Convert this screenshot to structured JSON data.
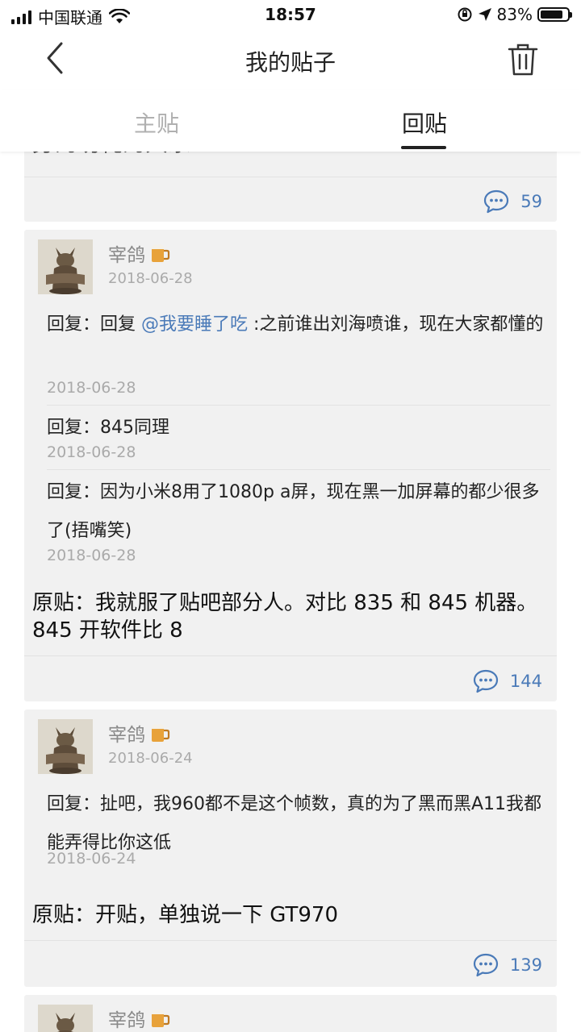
{
  "status_bar": {
    "carrier": "中国联通",
    "time": "18:57",
    "battery": "83%",
    "battery_level": 0.83
  },
  "nav": {
    "title": "我的贴子",
    "back_icon": "chevron-left-icon",
    "delete_icon": "trash-icon"
  },
  "tabs": [
    {
      "label": "主贴",
      "active": false
    },
    {
      "label": "回贴",
      "active": true
    }
  ],
  "top_card": {
    "partial_text": "身的功耗的大家",
    "comment_count": "59"
  },
  "posts": [
    {
      "username": "宰鸽",
      "date": "2018-06-28",
      "replies": [
        {
          "prefix": "回复：回复 ",
          "mention": "@我要睡了吃",
          "text": " :之前谁出刘海喷谁，现在大家都懂的",
          "date": "2018-06-28"
        },
        {
          "prefix": "回复：",
          "mention": "",
          "text": "845同理",
          "date": "2018-06-28"
        },
        {
          "prefix": "回复：",
          "mention": "",
          "text": "因为小米8用了1080p a屏，现在黑一加屏幕的都少很多了(捂嘴笑)",
          "date": "2018-06-28"
        }
      ],
      "original": "原贴：我就服了贴吧部分人。对比 835 和 845 机器。845 开软件比 8",
      "comment_count": "144"
    },
    {
      "username": "宰鸽",
      "date": "2018-06-24",
      "replies": [
        {
          "prefix": "回复：",
          "mention": "",
          "text": "扯吧，我960都不是这个帧数，真的为了黑而黑A11我都能弄得比你这低",
          "date": "2018-06-24"
        }
      ],
      "original": "原贴：开贴，单独说一下 GT970",
      "comment_count": "139"
    },
    {
      "username": "宰鸽"
    }
  ]
}
